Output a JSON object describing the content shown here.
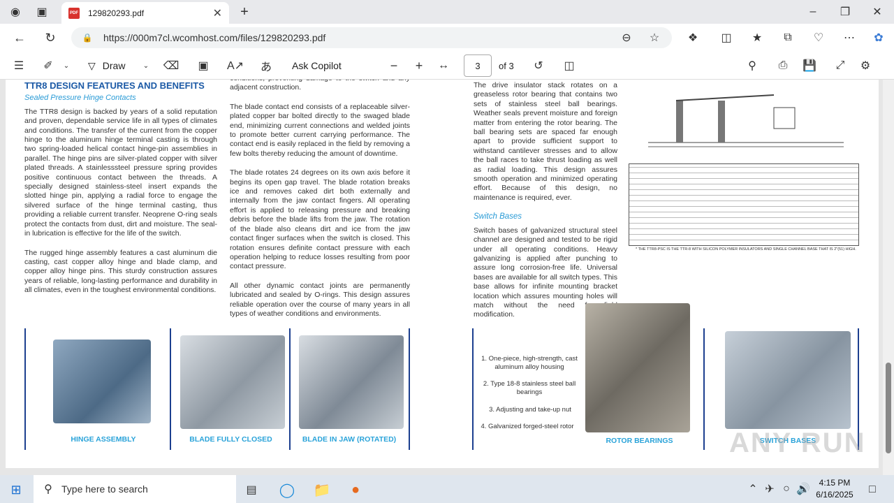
{
  "browser": {
    "tab_title": "129820293.pdf",
    "url": "https://000m7cl.wcomhost.com/files/129820293.pdf"
  },
  "pdf_toolbar": {
    "draw_label": "Draw",
    "ask_copilot_label": "Ask Copilot",
    "current_page": "3",
    "page_total": "of 3"
  },
  "document": {
    "heading": "TTR8 DESIGN FEATURES AND BENEFITS",
    "subheading": "Sealed Pressure Hinge Contacts",
    "col1_p1": "The TTR8 design is backed by years of a solid reputation and proven, dependable service life in all types of climates and conditions. The transfer of the current from the copper hinge to the aluminum hinge terminal casting is through two spring-loaded helical contact hinge-pin assemblies in parallel. The hinge pins are silver-plated copper with silver plated threads. A stainlesssteel pressure spring provides positive continuous contact between the threads. A specially designed stainless-steel insert expands the slotted hinge pin, applying a radial force to engage the silvered surface of the hinge terminal casting, thus providing a reliable current transfer. Neoprene O-ring seals protect the contacts from dust, dirt and moisture. The seal-in lubrication is effective for the life of the switch.",
    "col1_p2": "The rugged hinge assembly features a cast aluminum die casting, cast copper alloy hinge and blade clamp, and copper alloy hinge pins. This sturdy construction assures years of reliable, long-lasting performance and durability in all climates, even in the toughest environmental conditions.",
    "col2_p0": "conditions, preventing damage to the switch and any adjacent construction.",
    "col2_p1": "The blade contact end consists of a replaceable silver-plated copper bar bolted directly to the swaged blade end, minimizing current connections and welded joints to promote better current carrying performance. The contact end is easily replaced in the field by removing a few bolts thereby reducing the amount of downtime.",
    "col2_p2": "The blade rotates 24 degrees on its own axis before it begins its open gap travel. The blade rotation breaks ice and removes caked dirt both externally and internally from the jaw contact fingers. All operating effort is applied to releasing pressure and breaking debris before the blade lifts from the jaw. The rotation of the blade also cleans dirt and ice from the jaw contact finger surfaces when the switch is closed. This rotation ensures definite contact pressure with each operation helping to reduce losses resulting from poor contact pressure.",
    "col2_p3": "All other dynamic contact joints are permanently lubricated and sealed by O-rings. This design assures reliable operation over the course of many years in all types of weather conditions and environments.",
    "col3_p1": "The drive insulator stack rotates on a greaseless rotor bearing that contains two sets of stainless steel ball bearings. Weather seals prevent moisture and foreign matter from entering the rotor bearing. The ball bearing sets are spaced far enough apart to provide sufficient support to withstand cantilever stresses and to allow the ball races to take thrust loading as well as radial loading. This design assures smooth operation and minimized operating effort. Because of this design, no maintenance is required, ever.",
    "col3_sub": "Switch Bases",
    "col3_p2": "Switch bases of galvanized structural steel channel are designed and tested to be rigid under all operating conditions. Heavy galvanizing is applied after punching to assure long corrosion-free life. Universal bases are available for all switch types. This base allows for infinite mounting bracket location which assures mounting holes will match without the need for field modification.",
    "captions": [
      "HINGE ASSEMBLY",
      "BLADE FULLY CLOSED",
      "BLADE IN JAW (ROTATED)",
      "ROTOR BEARINGS",
      "SWITCH BASES"
    ],
    "features": [
      "1. One-piece, high-strength, cast aluminum alloy housing",
      "2. Type 18-8 stainless steel ball bearings",
      "3. Adjusting and take-up nut",
      "4. Galvanized forged-steel rotor"
    ],
    "table_footnote": "* THE TTR8-PSC IS THE TTR-8 WITH SILICON POLYMER INSULATORS AND SINGLE CHANNEL BASE THAT IS 2\"(51) HIGH."
  },
  "taskbar": {
    "search_placeholder": "Type here to search",
    "time": "4:15 PM",
    "date": "6/16/2025"
  },
  "watermark": "ANY RUN"
}
